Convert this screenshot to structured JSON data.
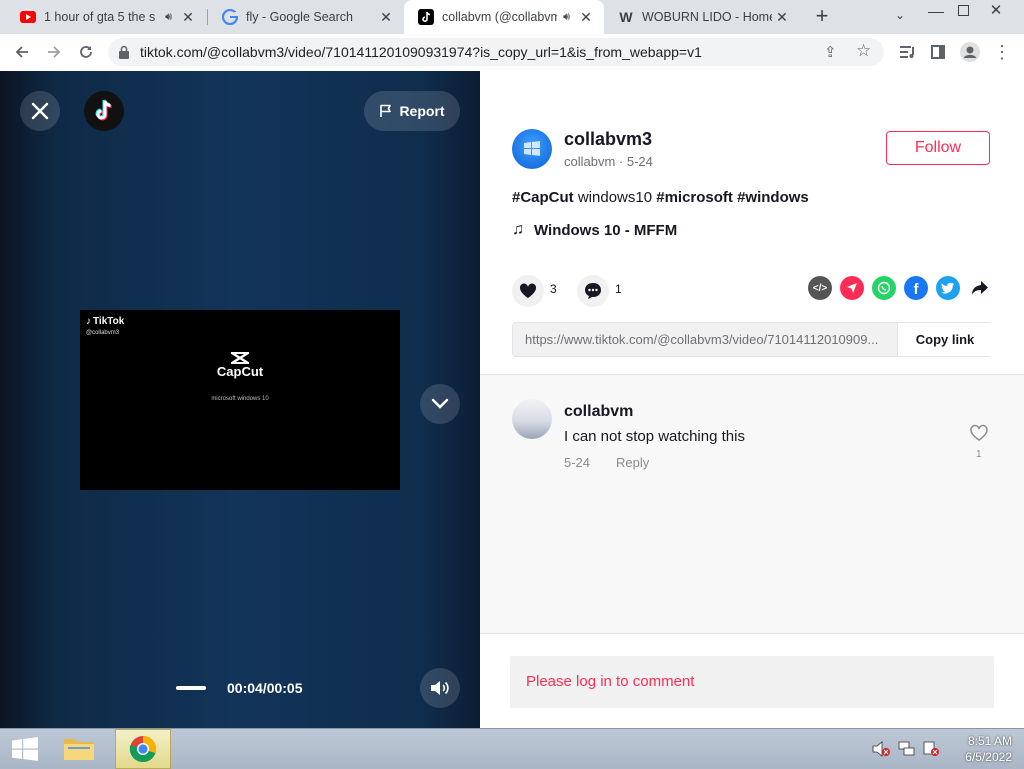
{
  "browser": {
    "tabs": [
      {
        "title": "1 hour of gta 5 the s",
        "favicon": "youtube-icon",
        "audio": true
      },
      {
        "title": "fly - Google Search",
        "favicon": "google-icon",
        "audio": false
      },
      {
        "title": "collabvm (@collabvm",
        "favicon": "tiktok-icon",
        "audio": true,
        "active": true
      },
      {
        "title": "WOBURN LIDO - Home",
        "favicon": "wix-icon",
        "audio": false
      }
    ],
    "url": "tiktok.com/@collabvm3/video/7101411201090931974?is_copy_url=1&is_from_webapp=v1"
  },
  "video": {
    "report_label": "Report",
    "time_display": "00:04/00:05",
    "preview": {
      "watermark": "TikTok",
      "watermark_user": "@collabvm3",
      "brand": "CapCut",
      "caption": "microsoft windows 10"
    }
  },
  "post": {
    "username": "collabvm3",
    "nickname_date": "collabvm · 5-24",
    "follow_label": "Follow",
    "tag_capcut": "#CapCut",
    "plain_word": "windows10",
    "tag_microsoft": "#microsoft",
    "tag_windows": "#windows",
    "music": "Windows 10 - MFFM",
    "like_count": "3",
    "comment_count": "1",
    "share_icons": [
      "embed-icon",
      "send-icon",
      "whatsapp-icon",
      "facebook-icon",
      "twitter-icon",
      "share-arrow-icon"
    ],
    "link_url": "https://www.tiktok.com/@collabvm3/video/71014112010909...",
    "copy_link_label": "Copy link"
  },
  "comments": [
    {
      "author": "collabvm",
      "text": "I can not stop watching this",
      "date": "5-24",
      "reply_label": "Reply",
      "likes": "1"
    }
  ],
  "login_prompt": "Please log in to comment",
  "taskbar": {
    "time": "8:51 AM",
    "date": "6/5/2022"
  },
  "colors": {
    "accent": "#fe2c55",
    "video_bg": "#123459",
    "whatsapp": "#25d366",
    "facebook": "#1877f2",
    "twitter": "#1da1f2",
    "send": "#fe2c55",
    "embed": "#555555"
  }
}
